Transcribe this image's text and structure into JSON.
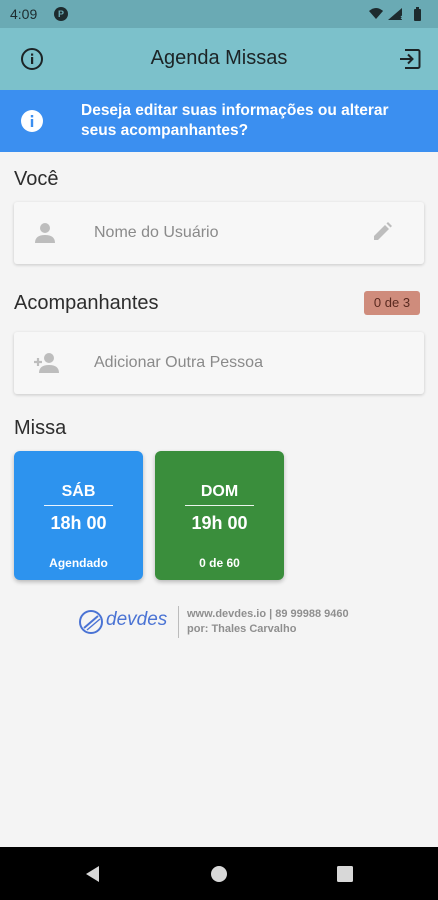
{
  "status_bar": {
    "time": "4:09",
    "app_badge": "P",
    "icons": [
      "wifi-icon",
      "signal-icon",
      "battery-icon"
    ]
  },
  "app_bar": {
    "title": "Agenda Missas",
    "left_icon": "info-icon",
    "right_icon": "logout-icon"
  },
  "banner": {
    "icon": "info-icon",
    "text": "Deseja editar suas informações ou alterar seus acompanhantes?"
  },
  "voce": {
    "label": "Você",
    "user_placeholder": "Nome do Usuário",
    "icon": "person-icon",
    "action_icon": "edit-icon"
  },
  "acompanhantes": {
    "label": "Acompanhantes",
    "counter": "0 de 3",
    "add_label": "Adicionar Outra Pessoa",
    "icon": "person-add-icon"
  },
  "missa": {
    "label": "Missa",
    "cards": [
      {
        "day": "SÁB",
        "time": "18h 00",
        "status": "Agendado",
        "color": "#2d93ee"
      },
      {
        "day": "DOM",
        "time": "19h 00",
        "status": "0 de 60",
        "color": "#3a8e3c"
      }
    ]
  },
  "footer": {
    "brand": "devdes",
    "line1": "www.devdes.io | 89 99988 9460",
    "line2": "por: Thales Carvalho"
  },
  "colors": {
    "app_bar": "#7cc1cb",
    "status_bar": "#6aaab4",
    "banner": "#3b8ff0",
    "badge": "#cf8c7c"
  },
  "nav_bar": {
    "buttons": [
      "back-icon",
      "home-icon",
      "recents-icon"
    ]
  }
}
